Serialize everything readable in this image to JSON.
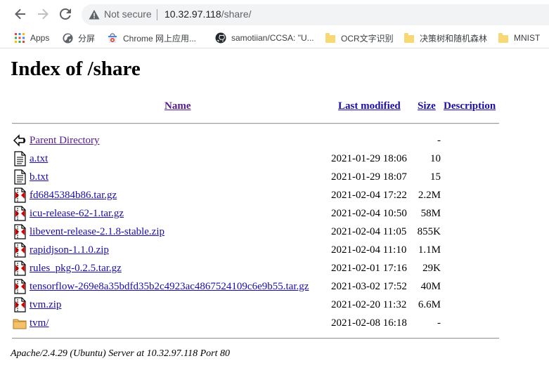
{
  "browser": {
    "security_label": "Not secure",
    "url_host": "10.32.97.118",
    "url_path": "/share/"
  },
  "bookmarks": [
    {
      "label": "Apps",
      "icon": "apps-grid-icon"
    },
    {
      "label": "分屏",
      "icon": "globe-icon"
    },
    {
      "label": "Chrome 网上应用...",
      "icon": "chrome-webstore-icon"
    },
    {
      "label": "samotiian/CCSA: \"U...",
      "icon": "github-icon"
    },
    {
      "label": "OCR文字识别",
      "icon": "folder-icon"
    },
    {
      "label": "决策树和随机森林",
      "icon": "folder-icon"
    },
    {
      "label": "MNIST",
      "icon": "folder-icon"
    }
  ],
  "page": {
    "title": "Index of /share",
    "columns": {
      "name": "Name",
      "last_modified": "Last modified",
      "size": "Size",
      "description": "Description"
    },
    "parent": {
      "label": "Parent Directory",
      "size": "-"
    },
    "entries": [
      {
        "name": "a.txt",
        "modified": "2021-01-29 18:06",
        "size": "10",
        "icon": "text-file-icon"
      },
      {
        "name": "b.txt",
        "modified": "2021-01-29 18:07",
        "size": "15",
        "icon": "text-file-icon"
      },
      {
        "name": "fd6845384b86.tar.gz",
        "modified": "2021-02-04 17:22",
        "size": "2.2M",
        "icon": "compressed-file-icon"
      },
      {
        "name": "icu-release-62-1.tar.gz",
        "modified": "2021-02-04 10:50",
        "size": "58M",
        "icon": "compressed-file-icon"
      },
      {
        "name": "libevent-release-2.1.8-stable.zip",
        "modified": "2021-02-04 11:05",
        "size": "855K",
        "icon": "compressed-file-icon"
      },
      {
        "name": "rapidjson-1.1.0.zip",
        "modified": "2021-02-04 11:10",
        "size": "1.1M",
        "icon": "compressed-file-icon"
      },
      {
        "name": "rules_pkg-0.2.5.tar.gz",
        "modified": "2021-02-01 17:16",
        "size": "29K",
        "icon": "compressed-file-icon"
      },
      {
        "name": "tensorflow-269e8a35bdfd35b2c4923ac4867524109c6e9b55.tar.gz",
        "modified": "2021-03-02 17:52",
        "size": "40M",
        "icon": "compressed-file-icon"
      },
      {
        "name": "tvm.zip",
        "modified": "2021-02-20 11:32",
        "size": "6.6M",
        "icon": "compressed-file-icon"
      },
      {
        "name": "tvm/",
        "modified": "2021-02-08 16:18",
        "size": "-",
        "icon": "folder-icon"
      }
    ],
    "footer": "Apache/2.4.29 (Ubuntu) Server at 10.32.97.118 Port 80"
  }
}
